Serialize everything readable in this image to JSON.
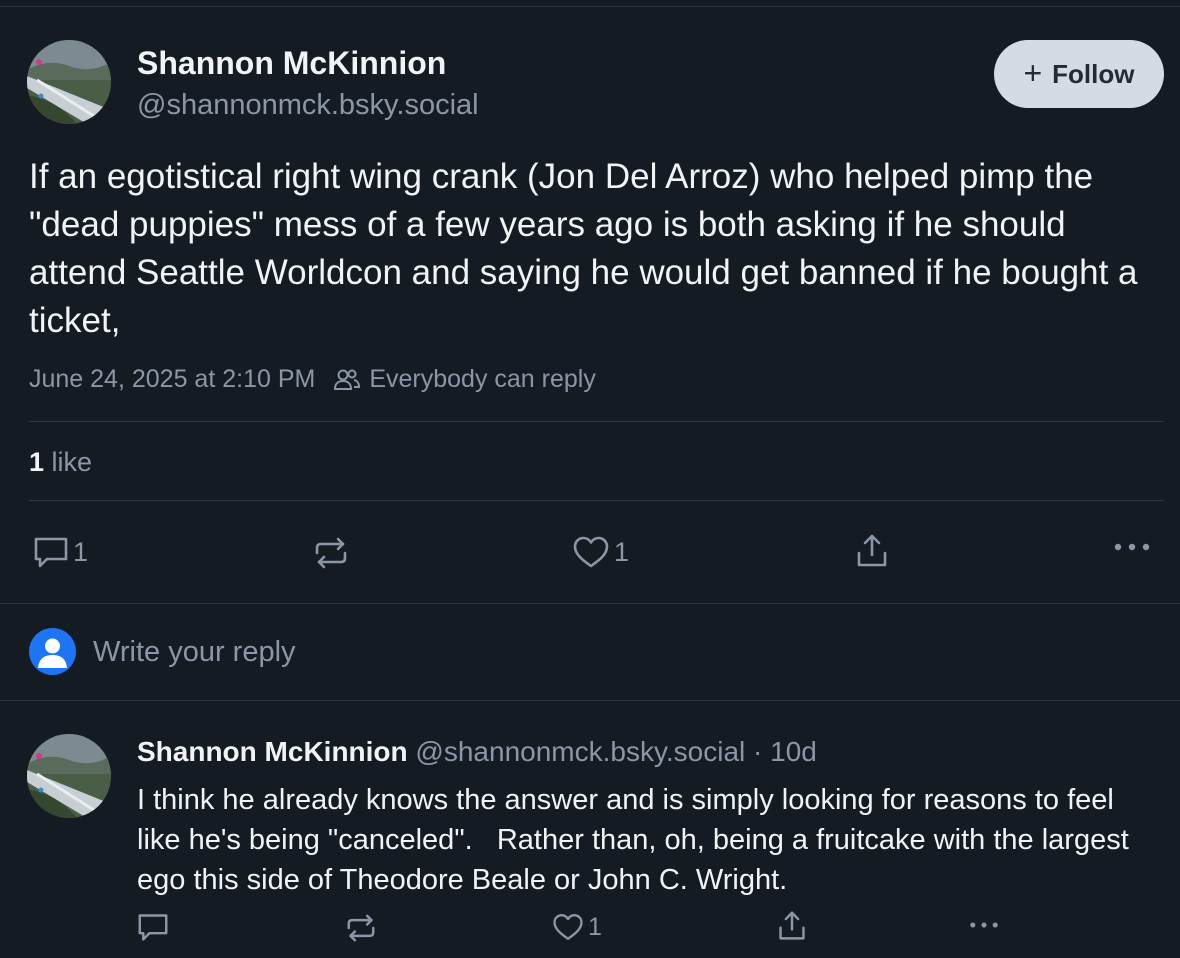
{
  "post": {
    "author_name": "Shannon McKinnion",
    "author_handle": "@shannonmck.bsky.social",
    "follow_label": "Follow",
    "text": "If an egotistical right wing crank (Jon Del Arroz) who helped pimp the \"dead puppies\" mess of a few years ago is both asking if he should attend Seattle Worldcon and saying he would get banned if he bought a ticket,",
    "timestamp": "June 24, 2025 at 2:10 PM",
    "reply_permission": "Everybody can reply",
    "like_count": "1",
    "like_label": "like",
    "actions": {
      "reply_count": "1",
      "like_count": "1"
    }
  },
  "composer": {
    "placeholder": "Write your reply"
  },
  "reply": {
    "author_name": "Shannon McKinnion",
    "author_handle": "@shannonmck.bsky.social",
    "separator": "·",
    "age": "10d",
    "text": "I think he already knows the answer and is simply looking for reasons to feel like he's being \"canceled\".   Rather than, oh, being a fruitcake with the largest ego this side of Theodore Beale or John C. Wright.",
    "actions": {
      "like_count": "1"
    }
  },
  "icons": {
    "reply": "speech-bubble-icon",
    "repost": "repost-arrows-icon",
    "like": "heart-icon",
    "share": "share-upload-icon",
    "more": "ellipsis-icon",
    "audience": "people-icon",
    "self_avatar": "default-user-avatar-icon"
  },
  "colors": {
    "background": "#151b23",
    "muted_text": "#8b97a6",
    "follow_button": "#d4dbe2",
    "self_avatar": "#1d74f5"
  }
}
